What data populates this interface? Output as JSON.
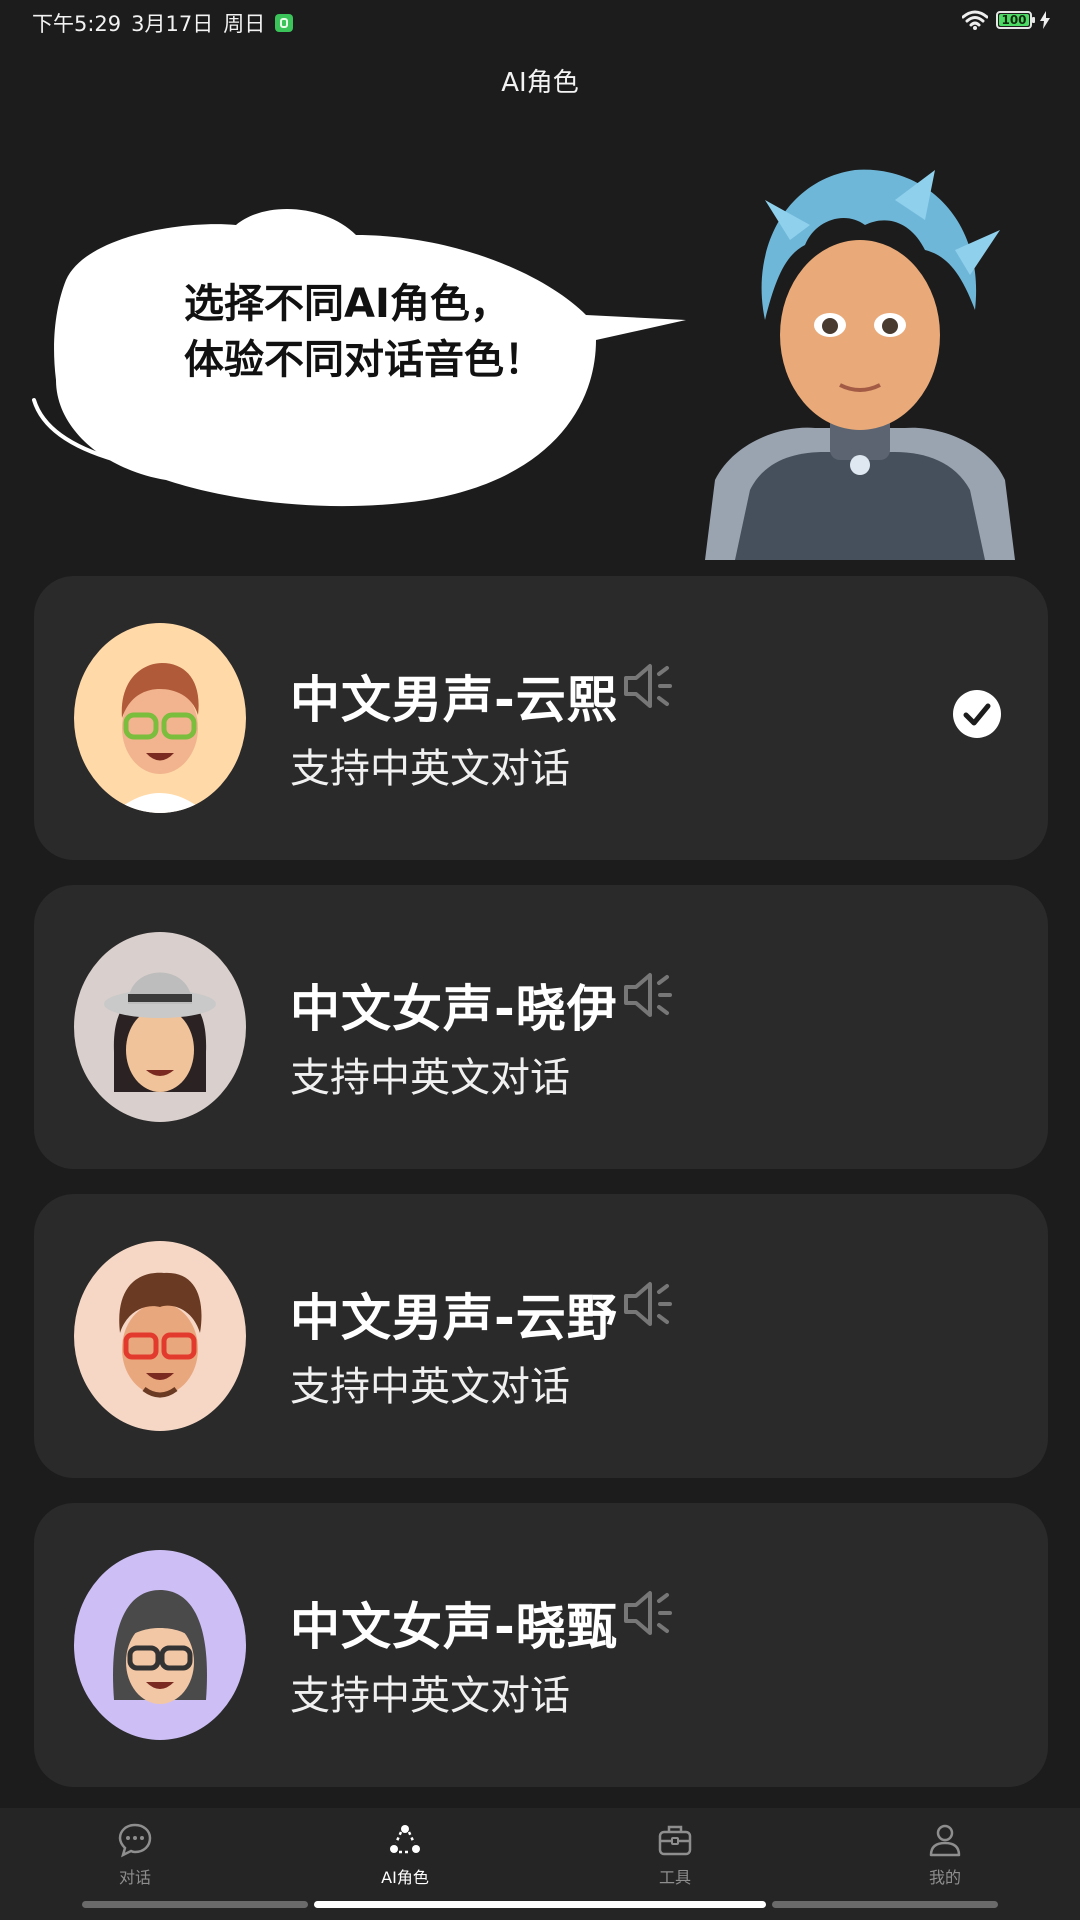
{
  "status_bar": {
    "time": "下午5:29",
    "date": "3月17日",
    "weekday": "周日",
    "battery_level": "100"
  },
  "header": {
    "title": "AI角色"
  },
  "hero": {
    "bubble_line1": "选择不同AI角色，",
    "bubble_line2": "体验不同对话音色！"
  },
  "voices": [
    {
      "name": "中文男声-云熙",
      "description": "支持中英文对话",
      "selected": true,
      "avatar_bg": "#ffd9a8"
    },
    {
      "name": "中文女声-晓伊",
      "description": "支持中英文对话",
      "selected": false,
      "avatar_bg": "#d9cfcc"
    },
    {
      "name": "中文男声-云野",
      "description": "支持中英文对话",
      "selected": false,
      "avatar_bg": "#f6d7c6"
    },
    {
      "name": "中文女声-晓甄",
      "description": "支持中英文对话",
      "selected": false,
      "avatar_bg": "#cdbff6"
    }
  ],
  "bottom_nav": {
    "items": [
      {
        "label": "对话",
        "icon": "chat-bubble-icon",
        "active": false
      },
      {
        "label": "AI角色",
        "icon": "ai-role-icon",
        "active": true
      },
      {
        "label": "工具",
        "icon": "toolbox-icon",
        "active": false
      },
      {
        "label": "我的",
        "icon": "profile-icon",
        "active": false
      }
    ]
  }
}
